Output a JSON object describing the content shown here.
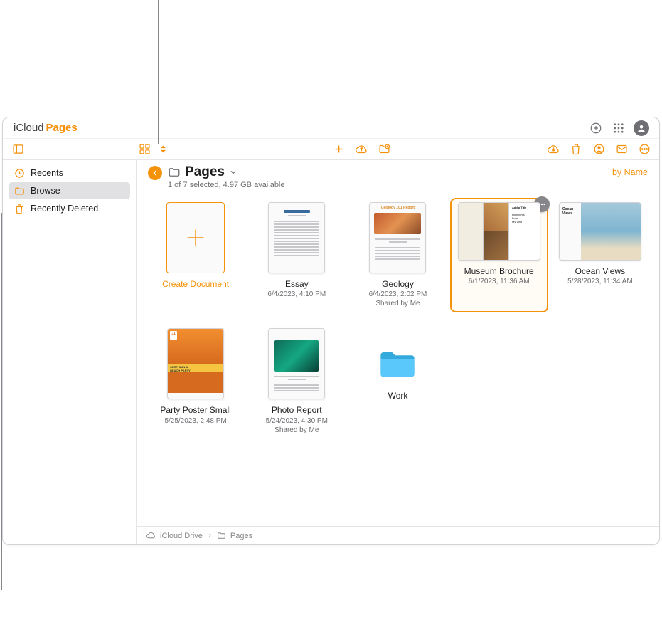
{
  "header": {
    "brand_prefix": "iCloud",
    "brand_app": "Pages"
  },
  "toolbar": {},
  "sidebar": {
    "items": [
      {
        "label": "Recents",
        "icon": "clock-icon",
        "selected": false
      },
      {
        "label": "Browse",
        "icon": "folder-icon",
        "selected": true
      },
      {
        "label": "Recently Deleted",
        "icon": "trash-icon",
        "selected": false
      }
    ]
  },
  "main": {
    "title": "Pages",
    "status": "1 of 7 selected, 4.97 GB available",
    "sort_label": "by Name"
  },
  "items": [
    {
      "kind": "create",
      "name": "Create Document"
    },
    {
      "kind": "doc",
      "name": "Essay",
      "date": "6/4/2023, 4:10 PM",
      "thumb": "essay"
    },
    {
      "kind": "doc",
      "name": "Geology",
      "date": "6/4/2023, 2:02 PM",
      "shared": "Shared by Me",
      "thumb": "geology"
    },
    {
      "kind": "doc",
      "name": "Museum Brochure",
      "date": "6/1/2023, 11:36 AM",
      "thumb": "museum",
      "wide": true,
      "selected": true
    },
    {
      "kind": "doc",
      "name": "Ocean Views",
      "date": "5/28/2023, 11:34 AM",
      "thumb": "ocean",
      "wide": true
    },
    {
      "kind": "doc",
      "name": "Party Poster Small",
      "date": "5/25/2023, 2:48 PM",
      "thumb": "poster"
    },
    {
      "kind": "doc",
      "name": "Photo Report",
      "date": "5/24/2023, 4:30 PM",
      "shared": "Shared by Me",
      "thumb": "photo"
    },
    {
      "kind": "folder",
      "name": "Work"
    }
  ],
  "breadcrumb": {
    "root": "iCloud Drive",
    "current": "Pages"
  }
}
